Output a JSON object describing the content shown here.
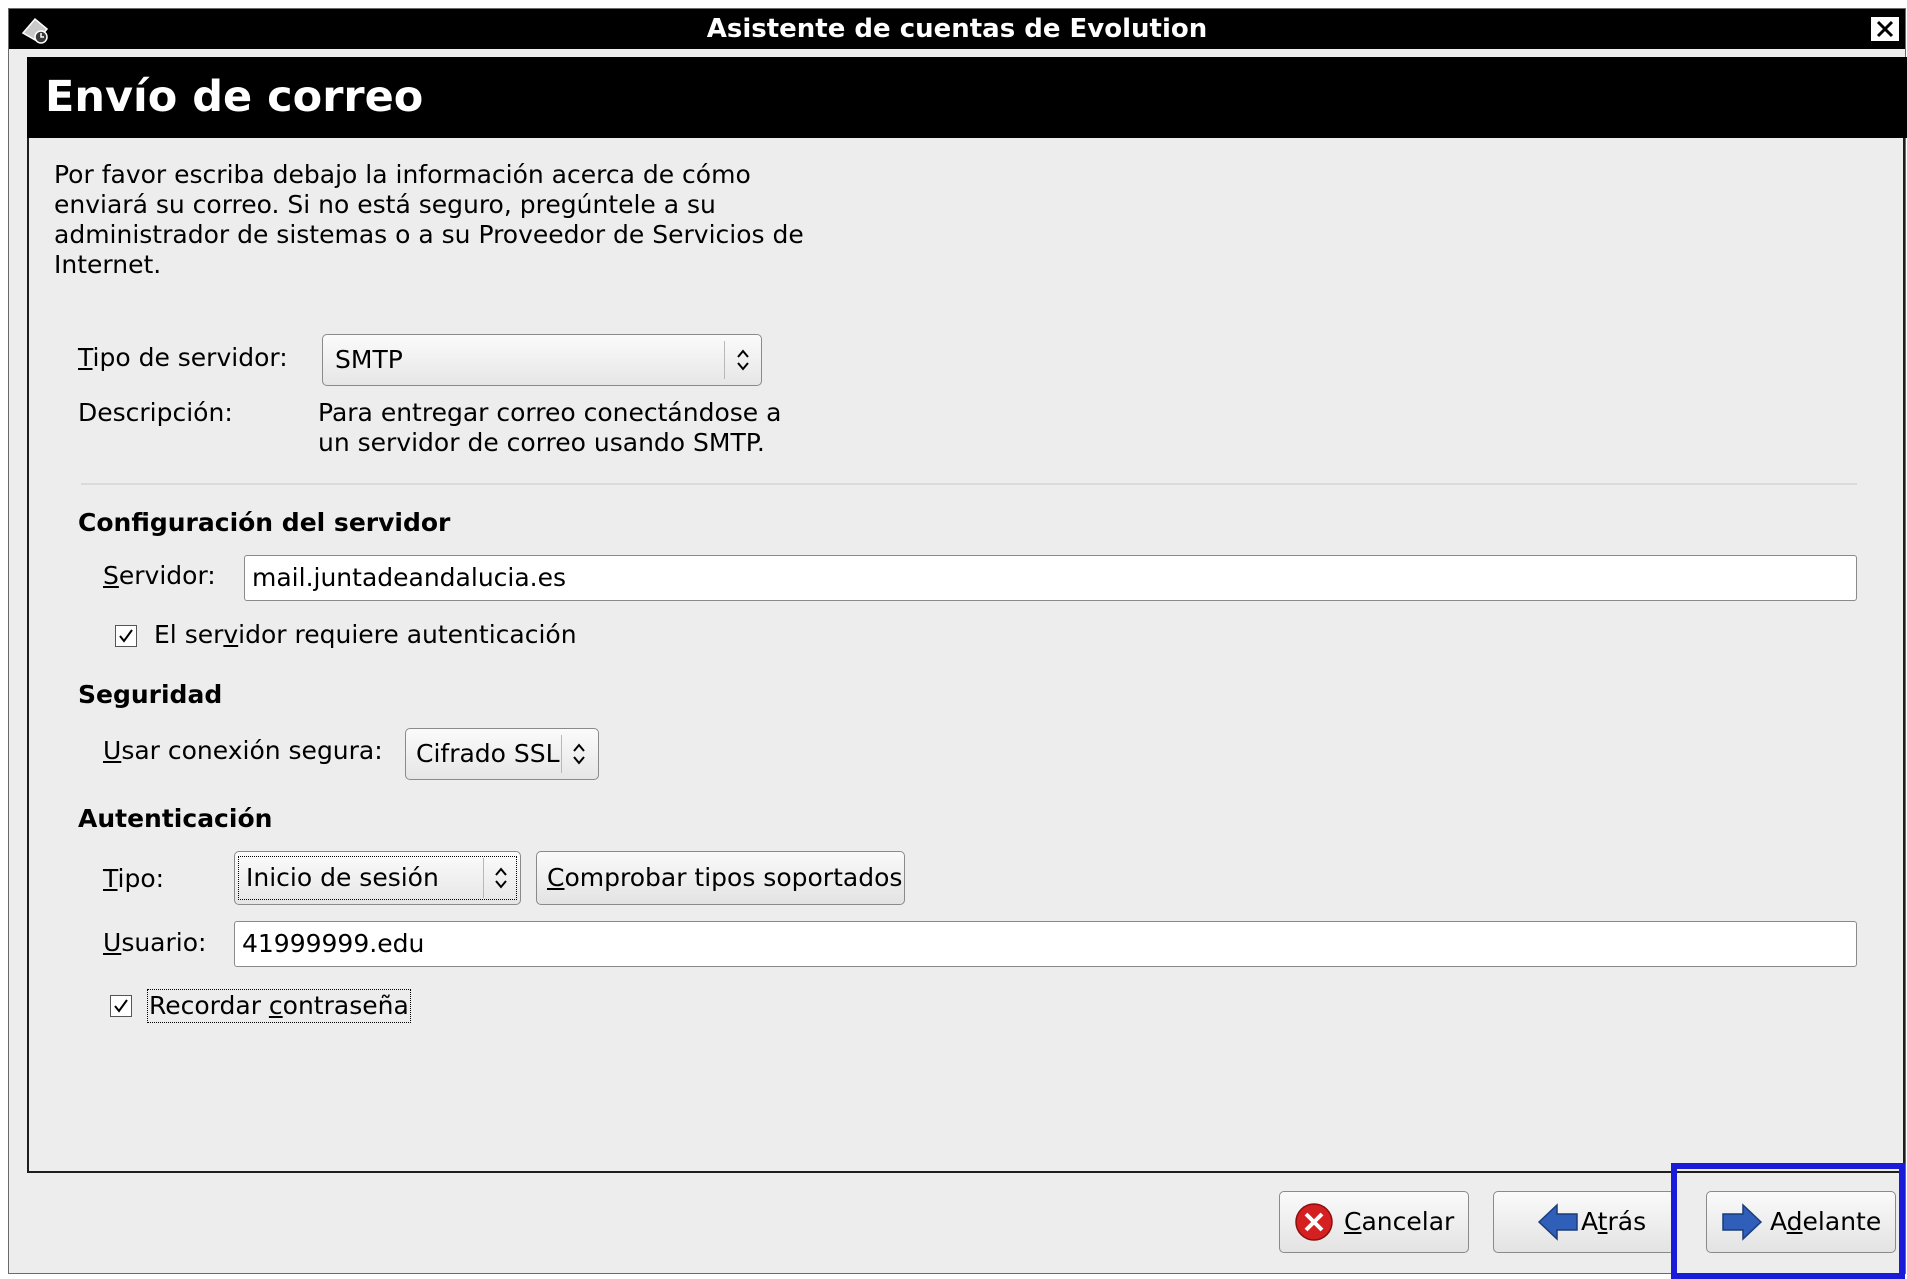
{
  "window": {
    "title": "Asistente de cuentas de Evolution",
    "icon": "evolution-mail-icon",
    "close_icon": "close-icon"
  },
  "page": {
    "title": "Envío de correo",
    "intro": "Por favor escriba debajo la información acerca de cómo enviará su correo. Si no está seguro, pregúntele a su administrador de sistemas o a su Proveedor de Servicios de Internet."
  },
  "server_type": {
    "label_mnemonic": "T",
    "label_rest": "ipo de servidor:",
    "value": "SMTP"
  },
  "description": {
    "label": "Descripción:",
    "text": "Para entregar correo conectándose a un servidor de correo usando SMTP."
  },
  "server_config": {
    "heading": "Configuración del servidor",
    "server_label_mnemonic": "S",
    "server_label_rest": "ervidor:",
    "server_value": "mail.juntadeandalucia.es",
    "auth_required_pre": "El ser",
    "auth_required_mnemonic": "v",
    "auth_required_post": "idor requiere autenticación",
    "auth_required_checked": true
  },
  "security": {
    "heading": "Seguridad",
    "label_mnemonic": "U",
    "label_rest": "sar conexión segura:",
    "value": "Cifrado SSL"
  },
  "authentication": {
    "heading": "Autenticación",
    "type_label_mnemonic": "T",
    "type_label_rest": "ipo:",
    "type_value": "Inicio de sesión",
    "check_button_mnemonic": "C",
    "check_button_rest": "omprobar tipos soportados",
    "user_label_mnemonic": "U",
    "user_label_rest": "suario:",
    "user_value": "41999999.edu",
    "remember_pre": "Recordar ",
    "remember_mnemonic": "c",
    "remember_post": "ontraseña",
    "remember_checked": true
  },
  "buttons": {
    "cancel_mnemonic": "C",
    "cancel_rest": "ancelar",
    "back_pre": "A",
    "back_mnemonic": "t",
    "back_post": "rás",
    "forward_pre": "A",
    "forward_mnemonic": "d",
    "forward_post": "elante"
  },
  "colors": {
    "highlight": "#1a1ad9",
    "cancel_icon": "#d42020",
    "arrow_icon": "#2f5fb8"
  }
}
